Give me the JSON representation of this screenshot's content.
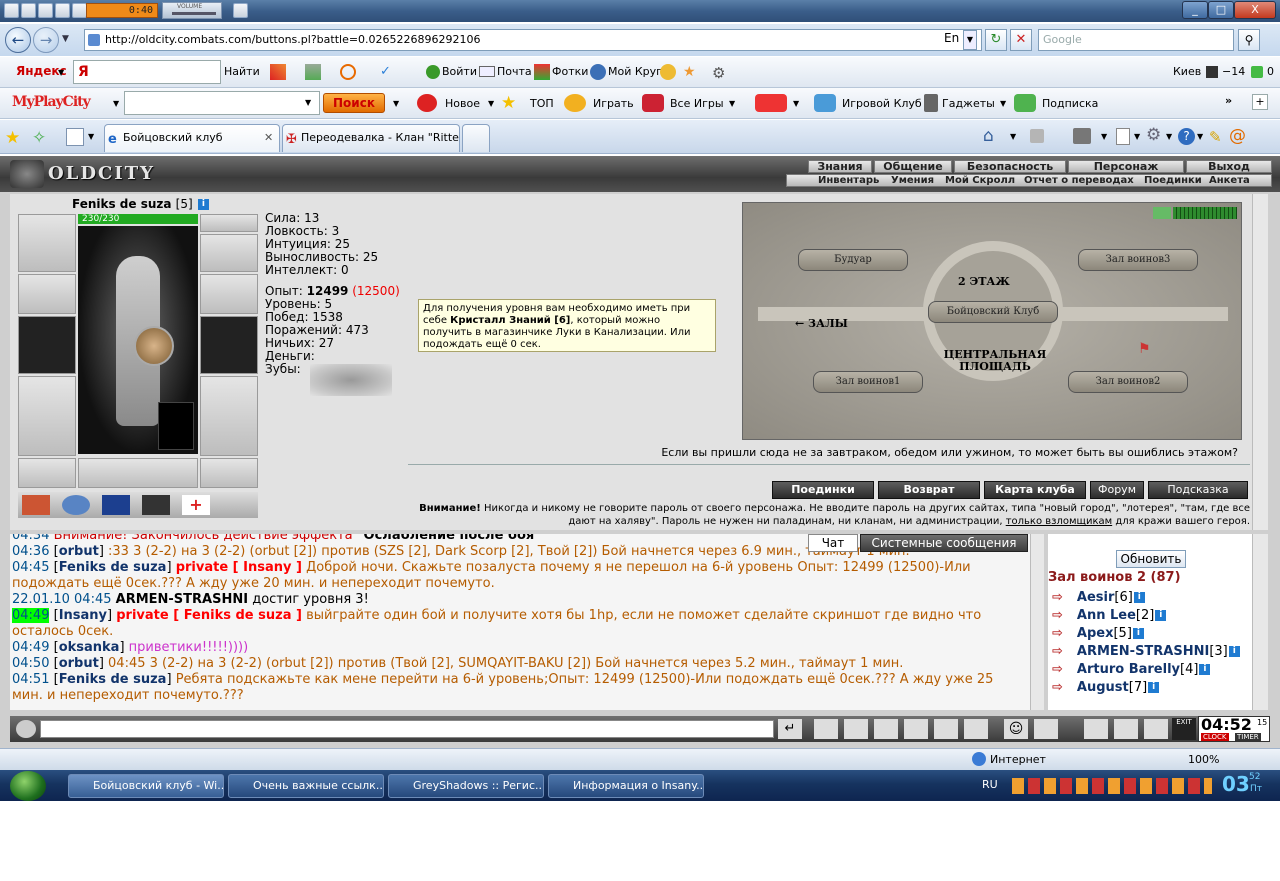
{
  "media": {
    "time": "0:40",
    "volume_label": "VOLUME"
  },
  "window": {
    "min": "_",
    "max": "□",
    "close": "X"
  },
  "address": {
    "url": "http://oldcity.combats.com/buttons.pl?battle=0.0265226896292106",
    "lang": "En",
    "search_placeholder": "Google"
  },
  "yandex": {
    "brand": "Яндекс",
    "search_value": "Я",
    "go": "Найти",
    "items": [
      "Войти",
      "Почта",
      "Фотки",
      "Мой Круг"
    ],
    "city": "Киев",
    "temp": "−14",
    "mail_count": "0"
  },
  "myplaycity": {
    "brand": "MyPlayCity",
    "search_btn": "Поиск",
    "items": [
      "Новое",
      "ТОП",
      "Играть",
      "Все Игры",
      "Игровой Клуб",
      "Гаджеты",
      "Подписка"
    ]
  },
  "tabs": [
    {
      "label": "Бойцовский клуб",
      "active": true
    },
    {
      "label": "Переодевалка - Клан \"Ritte...",
      "active": false
    }
  ],
  "game": {
    "logo": "OLDCITY",
    "menu_top": [
      "Знания",
      "Общение",
      "Безопасность",
      "Персонаж",
      "Выход"
    ],
    "menu_sub": [
      "Инвентарь",
      "Умения",
      "Мой Скролл",
      "Отчет о переводах",
      "Поединки",
      "Анкета"
    ],
    "character": {
      "name": "Feniks de suza",
      "level": "[5]",
      "hp": "230/230",
      "stats": [
        {
          "label": "Сила:",
          "value": "13"
        },
        {
          "label": "Ловкость:",
          "value": "3"
        },
        {
          "label": "Интуиция:",
          "value": "25"
        },
        {
          "label": "Выносливость:",
          "value": "25"
        },
        {
          "label": "Интеллект:",
          "value": "0"
        }
      ],
      "exp_label": "Опыт:",
      "exp_value": "12499",
      "exp_next": "(12500)",
      "info": [
        {
          "label": "Уровень:",
          "value": "5"
        },
        {
          "label": "Побед:",
          "value": "1538"
        },
        {
          "label": "Поражений:",
          "value": "473"
        },
        {
          "label": "Ничьих:",
          "value": "27"
        },
        {
          "label": "Деньги:",
          "value": ""
        },
        {
          "label": "Зубы:",
          "value": ""
        }
      ]
    },
    "tooltip": {
      "part1": "Для получения уровня вам необходимо иметь при себе ",
      "bold": "Кристалл Знаний [6]",
      "part2": ", который можно получить в магазинчике Луки в Канализации. Или подождать ещё 0 сек."
    },
    "map": {
      "labels": [
        "Будуар",
        "Зал воинов3",
        "2 ЭТАЖ",
        "Бойцовский Клуб",
        "ЗАЛЫ",
        "ЦЕНТРАЛЬНАЯ ПЛОЩАДЬ",
        "Зал воинов1",
        "Зал воинов2"
      ],
      "caption": "Если вы пришли сюда не за завтраком, обедом или ужином, то может быть вы ошиблись этажом?"
    },
    "buttons": [
      "Поединки",
      "Возврат",
      "Карта клуба",
      "Форум",
      "Подсказка"
    ],
    "warning_bold": "Внимание!",
    "warning_text": " Никогда и никому не говорите пароль от своего персонажа. Не вводите пароль на других сайтах, типа \"новый город\", \"лотерея\", \"там, где все дают на халяву\". Пароль не нужен ни паладинам, ни кланам, ни администрации, ",
    "warning_link": "только взломщикам",
    "warning_end": " для кражи вашего героя."
  },
  "chat": {
    "tabs": [
      "Чат",
      "Системные сообщения"
    ],
    "lines": [
      {
        "t": "04:34",
        "pre": "Внимание! Закончилось действие эффекта ",
        "bold": "\"Ослабление после боя\""
      },
      {
        "t": "04:36",
        "nick": "orbut",
        "msg": ":33 3 (2-2) на 3 (2-2) (orbut [2]) против (SZS [2], Dark Scorp [2], Твой [2]) Бой начнется через 6.9 мин., таймаут 1 мин."
      },
      {
        "t": "04:45",
        "nick": "Feniks de suza",
        "priv": "private [ Insany ]",
        "msg": "Доброй ночи. Скажьте позалуста почему я не перешол на 6-й уровень Опыт: 12499 (12500)-Или подождать ещё 0сек.??? А жду уже 20 мин. и непереходит почемуто."
      },
      {
        "t": "22.01.10 04:45",
        "sys": "ARMEN-STRASHNI",
        "msg": "достиг уровня 3!"
      },
      {
        "t": "04:49",
        "nick": "Insany",
        "priv": "private [ Feniks de suza ]",
        "msg": "выйграйте один бой и получите хотя бы 1hp, если не поможет сделайте скриншот где видно что осталось 0сек."
      },
      {
        "t": "04:49",
        "nick": "oksanka",
        "msg": "приветики!!!!!))))"
      },
      {
        "t": "04:50",
        "nick": "orbut",
        "msg": "04:45 3 (2-2) на 3 (2-2) (orbut [2]) против (Твой [2], SUMQAYIT-BAKU [2]) Бой начнется через 5.2 мин., таймаут 1 мин."
      },
      {
        "t": "04:51",
        "nick": "Feniks de suza",
        "msg": "Ребята подскажьте как мене перейти на 6-й уровень;Опыт: 12499 (12500)-Или подождать ещё 0сек.??? А жду уже 25 мин. и непереходит почемуто.???"
      }
    ]
  },
  "users": {
    "refresh": "Обновить",
    "room": "Зал воинов 2 (87)",
    "list": [
      {
        "name": "Aesir",
        "lvl": "[6]"
      },
      {
        "name": "Ann Lee",
        "lvl": "[2]"
      },
      {
        "name": "Apex",
        "lvl": "[5]"
      },
      {
        "name": "ARMEN-STRASHNI",
        "lvl": "[3]"
      },
      {
        "name": "Arturo Barelly",
        "lvl": "[4]"
      },
      {
        "name": "August",
        "lvl": "[7]"
      }
    ]
  },
  "clock": {
    "time": "04:52",
    "sec": "15",
    "clock_label": "CLOCK",
    "timer_label": "TIMER",
    "exit": "EXIT"
  },
  "status": {
    "zone": "Интернет",
    "zoom": "100%"
  },
  "taskbar": {
    "tasks": [
      "Бойцовский клуб - Wi...",
      "Очень важные ссылк...",
      "GreyShadows :: Регис...",
      "Информация о Insany..."
    ],
    "lang": "RU",
    "time": "03",
    "time2": "52",
    "day": "Пт"
  }
}
